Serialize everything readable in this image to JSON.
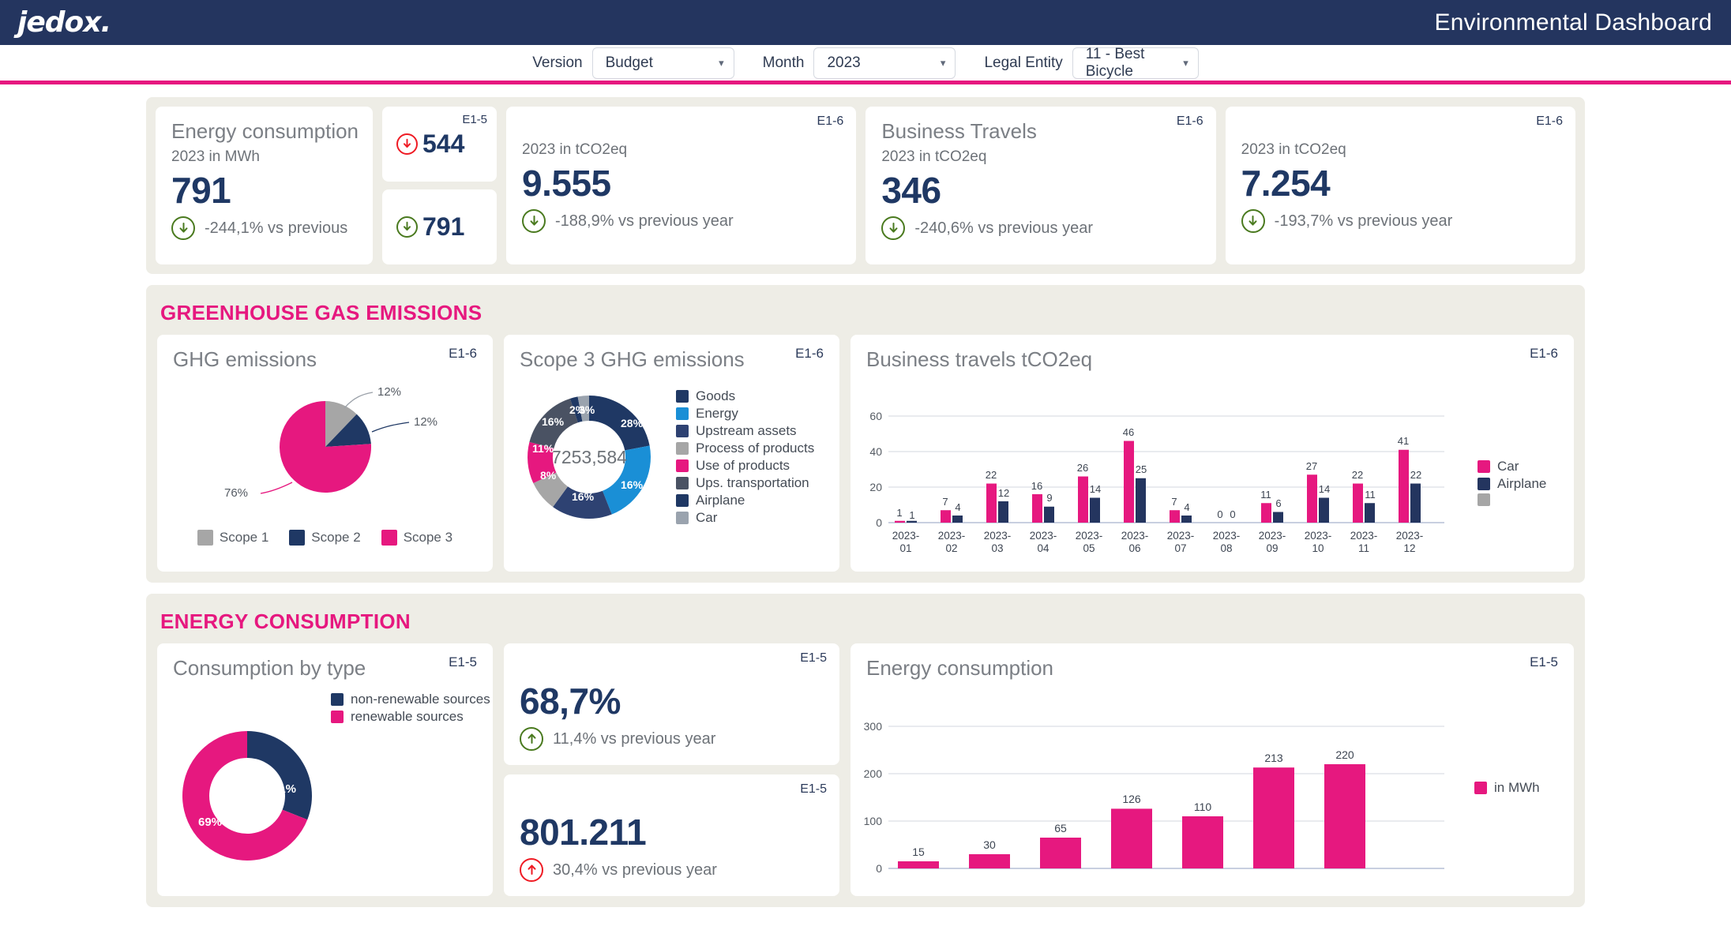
{
  "header": {
    "logo_text": "jedox.",
    "title": "Environmental Dashboard"
  },
  "filters": [
    {
      "label": "Version",
      "value": "Budget",
      "caret": "chevron-down-icon"
    },
    {
      "label": "Month",
      "value": "2023",
      "caret": "chevron-down-icon"
    },
    {
      "label": "Legal Entity",
      "value": "11 - Best Bicycle",
      "caret": "chevron-down-icon"
    }
  ],
  "kpis": {
    "energy": {
      "title": "Energy consumption",
      "subtitle": "2023 in MWh",
      "value": "791",
      "delta": "-244,1% vs previous",
      "delta_dir": "down",
      "delta_color": "#4a7a1f"
    },
    "mini_top": {
      "tag": "E1-5",
      "value": "544",
      "dir": "down",
      "color": "#ef1b24"
    },
    "mini_bottom": {
      "tag": "",
      "value": "791",
      "dir": "down",
      "color": "#4a7a1f"
    },
    "ghg": {
      "tag": "E1-6",
      "subtitle": "2023 in tCO2eq",
      "value": "9.555",
      "delta": "-188,9% vs previous year",
      "delta_dir": "down",
      "delta_color": "#4a7a1f"
    },
    "travel": {
      "tag": "E1-6",
      "title": "Business Travels",
      "subtitle": "2023 in tCO2eq",
      "value": "346",
      "delta": "-240,6% vs previous year",
      "delta_dir": "down",
      "delta_color": "#4a7a1f"
    },
    "other": {
      "tag": "E1-6",
      "subtitle": "2023 in tCO2eq",
      "value": "7.254",
      "delta": "-193,7% vs previous year",
      "delta_dir": "down",
      "delta_color": "#4a7a1f"
    }
  },
  "sections": {
    "ghg_title": "GREENHOUSE GAS EMISSIONS",
    "energy_title": "ENERGY CONSUMPTION"
  },
  "cards": {
    "ghg_emissions": {
      "title": "GHG emissions",
      "tag": "E1-6"
    },
    "scope3": {
      "title": "Scope 3 GHG emissions",
      "tag": "E1-6",
      "center_value": "7253,584"
    },
    "business_travels": {
      "title": "Business travels tCO2eq",
      "tag": "E1-6"
    },
    "consumption_by_type": {
      "title": "Consumption by type",
      "tag": "E1-5"
    },
    "energy_pct": {
      "tag": "E1-5",
      "value": "68,7%",
      "delta": "11,4% vs previous year",
      "delta_dir": "up",
      "delta_color": "#4a7a1f"
    },
    "energy_abs": {
      "tag": "E1-5",
      "value": "801.211",
      "delta": "30,4% vs previous year",
      "delta_dir": "up",
      "delta_color": "#ef1b24"
    },
    "energy_chart": {
      "title": "Energy consumption",
      "tag": "E1-5"
    }
  },
  "colors": {
    "brand_pink": "#e6187f",
    "navy": "#24355f",
    "dark_navy": "#1f3864",
    "mid_navy": "#2e4272",
    "blue": "#1a8fd6",
    "gray": "#a6a6a6",
    "slate": "#4a5263",
    "light_gray": "#9aa3ae",
    "band_bg": "#eeede6",
    "green": "#4a7a1f",
    "red": "#ef1b24"
  },
  "chart_data": [
    {
      "type": "pie",
      "id": "ghg-emissions-pie",
      "title": "GHG emissions",
      "labels": [
        "Scope 1",
        "Scope 2",
        "Scope 3"
      ],
      "values": [
        12,
        12,
        76
      ],
      "data_labels": [
        "12%",
        "12%",
        "76%"
      ],
      "colors": [
        "#a6a6a6",
        "#1f3864",
        "#e6187f"
      ],
      "legend_position": "bottom"
    },
    {
      "type": "pie",
      "id": "scope3-donut",
      "title": "Scope 3 GHG emissions",
      "center_label": "7253,584",
      "labels": [
        "Goods",
        "Energy",
        "Upstream assets",
        "Process of products",
        "Use of products",
        "Ups. transportation",
        "Airplane",
        "Car"
      ],
      "values": [
        28,
        16,
        16,
        8,
        11,
        16,
        2,
        3
      ],
      "data_labels": [
        "28%",
        "16%",
        "16%",
        "8%",
        "11%",
        "16%",
        "2%",
        "3%"
      ],
      "colors": [
        "#1f3864",
        "#1a8fd6",
        "#2e4272",
        "#a6a6a6",
        "#e6187f",
        "#4a5263",
        "#1f3864",
        "#9aa3ae"
      ],
      "legend_position": "right"
    },
    {
      "type": "bar",
      "id": "business-travels-bar",
      "title": "Business travels tCO2eq",
      "categories": [
        "2023-01",
        "2023-02",
        "2023-03",
        "2023-04",
        "2023-05",
        "2023-06",
        "2023-07",
        "2023-08",
        "2023-09",
        "2023-10",
        "2023-11",
        "2023-12"
      ],
      "series": [
        {
          "name": "Car",
          "color": "#e6187f",
          "values": [
            1,
            7,
            22,
            16,
            26,
            46,
            7,
            0,
            11,
            27,
            22,
            41
          ]
        },
        {
          "name": "Airplane",
          "color": "#24355f",
          "values": [
            1,
            4,
            12,
            9,
            14,
            25,
            4,
            0,
            6,
            14,
            11,
            22
          ]
        },
        {
          "name": "",
          "color": "#a6a6a6",
          "values": []
        }
      ],
      "ylim": [
        0,
        60
      ],
      "yticks": [
        0,
        20,
        40,
        60
      ],
      "ylabel": "",
      "xlabel": "",
      "grid": true,
      "legend_position": "right"
    },
    {
      "type": "pie",
      "id": "consumption-by-type-donut",
      "title": "Consumption by type",
      "labels": [
        "non-renewable sources",
        "renewable sources"
      ],
      "values": [
        31,
        69
      ],
      "data_labels": [
        "31%",
        "69%"
      ],
      "colors": [
        "#1f3864",
        "#e6187f"
      ],
      "legend_position": "top-right"
    },
    {
      "type": "bar",
      "id": "energy-consumption-bar",
      "title": "Energy consumption",
      "categories": [
        "",
        "",
        "",
        "",
        "",
        "",
        ""
      ],
      "series": [
        {
          "name": "in MWh",
          "color": "#e6187f",
          "values": [
            15,
            30,
            65,
            126,
            110,
            213,
            220
          ]
        }
      ],
      "ylim": [
        0,
        300
      ],
      "yticks": [
        0,
        100,
        200,
        300
      ],
      "ylabel": "",
      "xlabel": "",
      "grid": true,
      "legend_position": "right"
    }
  ]
}
